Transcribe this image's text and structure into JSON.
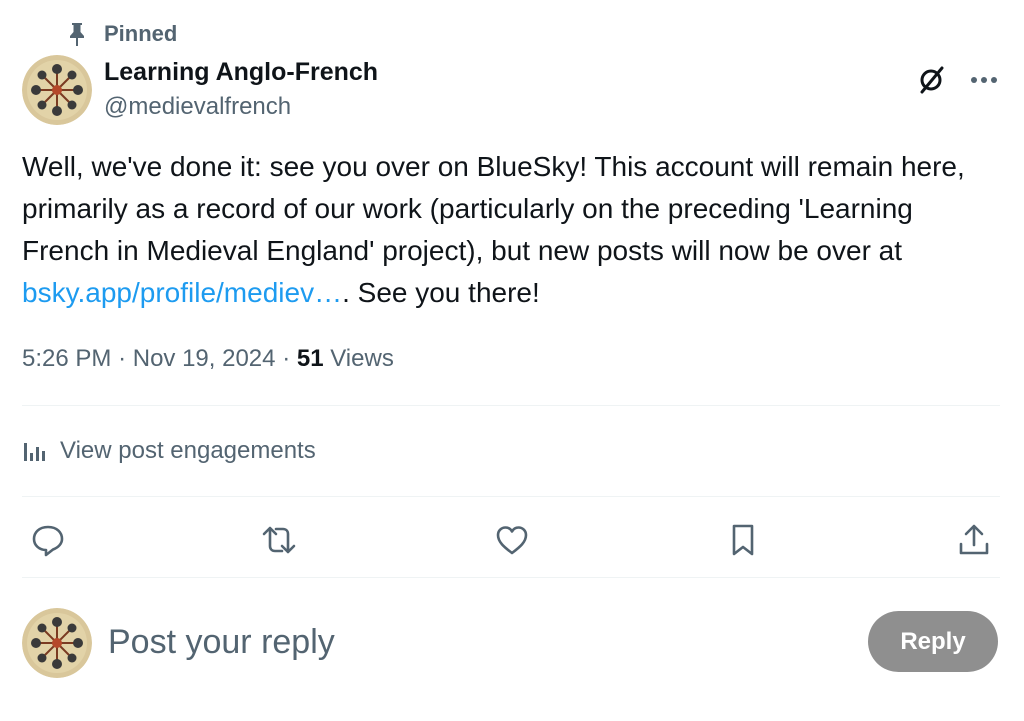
{
  "pinned": {
    "label": "Pinned"
  },
  "author": {
    "name": "Learning Anglo-French",
    "handle": "@medievalfrench"
  },
  "post": {
    "text_before_link": "Well, we've done it: see you over on BlueSky! This account will remain here, primarily as a record of our work (particularly on the preceding 'Learning French in Medieval England' project), but new posts will now be over at ",
    "link_text": "bsky.app/profile/mediev…",
    "text_after_link": ". See you there!"
  },
  "meta": {
    "time": "5:26 PM",
    "separator": "·",
    "date": "Nov 19, 2024",
    "views_count": "51",
    "views_label": "Views"
  },
  "engagements": {
    "label": "View post engagements"
  },
  "actions": {
    "icons": [
      "reply-icon",
      "repost-icon",
      "like-icon",
      "bookmark-icon",
      "share-icon"
    ]
  },
  "reply": {
    "placeholder": "Post your reply",
    "button_label": "Reply"
  },
  "colors": {
    "text": "#0f1419",
    "secondary": "#536471",
    "link": "#1d9bf0",
    "reply_button_bg": "#8f8f8f",
    "divider": "#eff3f4"
  }
}
